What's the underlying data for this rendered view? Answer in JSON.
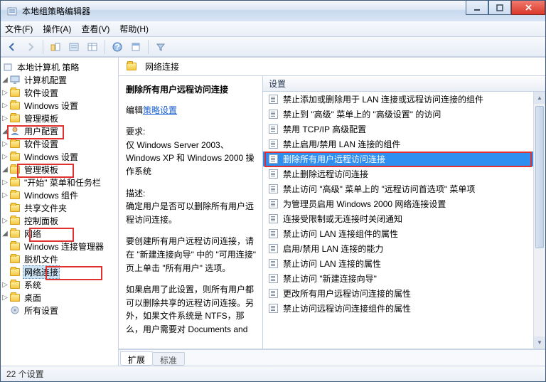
{
  "window": {
    "title": "本地组策略编辑器"
  },
  "menu": {
    "file": "文件(F)",
    "action": "操作(A)",
    "view": "查看(V)",
    "help": "帮助(H)"
  },
  "tree": {
    "root": "本地计算机 策略",
    "computer": "计算机配置",
    "soft1": "软件设置",
    "win1": "Windows 设置",
    "admin1": "管理模板",
    "user": "用户配置",
    "soft2": "软件设置",
    "win2": "Windows 设置",
    "admin2": "管理模板",
    "start": "\"开始\" 菜单和任务栏",
    "wincomp": "Windows 组件",
    "shared": "共享文件夹",
    "ctrlpanel": "控制面板",
    "network": "网络",
    "winconn": "Windows 连接管理器",
    "offline": "脱机文件",
    "netconn": "网络连接",
    "system": "系统",
    "desktop": "桌面",
    "allsettings": "所有设置"
  },
  "path": {
    "label": "网络连接"
  },
  "detail": {
    "title": "删除所有用户远程访问连接",
    "editPrefix": "编辑",
    "editLink": "策略设置",
    "reqLabel": "要求:",
    "reqBody1": "仅 Windows Server 2003、",
    "reqBody2": "Windows XP 和 Windows 2000 操作系统",
    "descLabel": "描述:",
    "desc1": "确定用户是否可以删除所有用户远程访问连接。",
    "desc2": "要创建所有用户远程访问连接，请在 \"新建连接向导\" 中的 \"可用连接\" 页上单击 \"所有用户\" 选项。",
    "desc3": "如果启用了此设置，则所有用户都可以删除共享的远程访问连接。另外，如果文件系统是 NTFS，那么，用户需要对 Documents and"
  },
  "list": {
    "header": "设置",
    "items": [
      "禁止添加或删除用于 LAN 连接或远程访问连接的组件",
      "禁止到 \"高级\" 菜单上的 \"高级设置\" 的访问",
      "禁用 TCP/IP 高级配置",
      "禁止启用/禁用 LAN 连接的组件",
      "删除所有用户远程访问连接",
      "禁止删除远程访问连接",
      "禁止访问 \"高级\" 菜单上的 \"远程访问首选项\" 菜单项",
      "为管理员启用 Windows 2000 网络连接设置",
      "连接受限制或无连接时关闭通知",
      "禁止访问 LAN 连接组件的属性",
      "启用/禁用 LAN 连接的能力",
      "禁止访问 LAN 连接的属性",
      "禁止访问 \"新建连接向导\"",
      "更改所有用户远程访问连接的属性",
      "禁止访问远程访问连接组件的属性"
    ],
    "selectedIndex": 4
  },
  "tabs": {
    "extended": "扩展",
    "standard": "标准"
  },
  "status": {
    "text": "22 个设置"
  }
}
